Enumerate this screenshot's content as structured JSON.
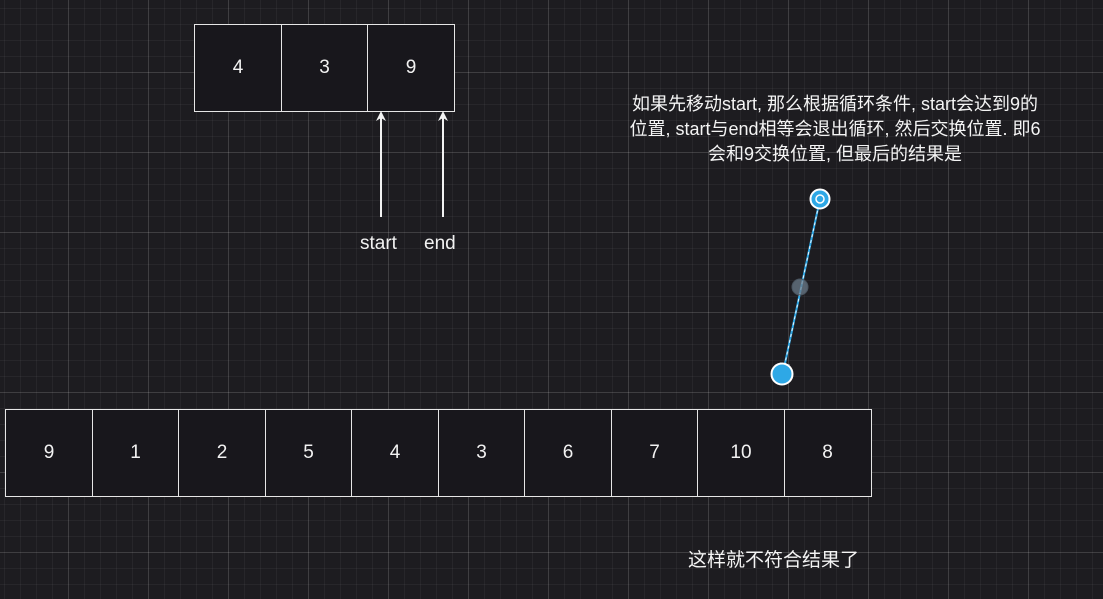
{
  "top_array": [
    "4",
    "3",
    "9"
  ],
  "pointers": {
    "start_label": "start",
    "end_label": "end"
  },
  "annotation": {
    "line1": "如果先移动start, 那么根据循环条件, start会达到9的",
    "line2": "位置, start与end相等会退出循环, 然后交换位置. 即6",
    "line3": "会和9交换位置, 但最后的结果是"
  },
  "bottom_array": [
    "9",
    "1",
    "2",
    "5",
    "4",
    "3",
    "6",
    "7",
    "10",
    "8"
  ],
  "conclusion": "这样就不符合结果了",
  "colors": {
    "background": "#1d1c20",
    "cell_border": "#e6e6e6",
    "connector": "#2ea8e6"
  }
}
